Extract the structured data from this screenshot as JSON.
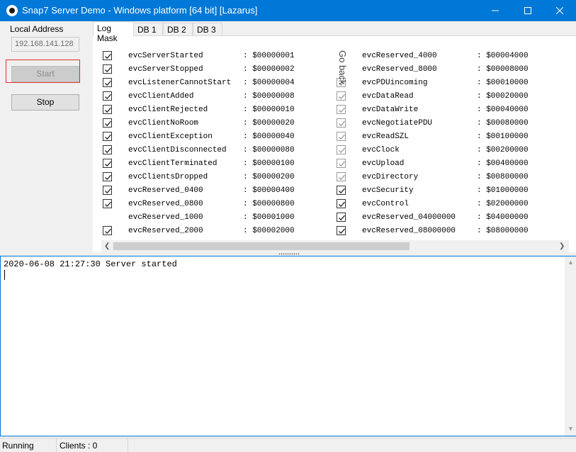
{
  "window": {
    "title": "Snap7 Server Demo - Windows platform [64 bit] [Lazarus]"
  },
  "left": {
    "address_label": "Local Address",
    "address_value": "192.168.141.128",
    "start_label": "Start",
    "stop_label": "Stop"
  },
  "tabs": [
    "Log Mask",
    "DB 1",
    "DB 2",
    "DB 3"
  ],
  "overlay_text": "Go back",
  "mask_left": [
    {
      "name": "evcServerStarted",
      "value": ": $00000001",
      "checked": true
    },
    {
      "name": "evcServerStopped",
      "value": ": $00000002",
      "checked": true
    },
    {
      "name": "evcListenerCannotStart",
      "value": ": $00000004",
      "checked": true
    },
    {
      "name": "evcClientAdded",
      "value": ": $00000008",
      "checked": true
    },
    {
      "name": "evcClientRejected",
      "value": ": $00000010",
      "checked": true
    },
    {
      "name": "evcClientNoRoom",
      "value": ": $00000020",
      "checked": true
    },
    {
      "name": "evcClientException",
      "value": ": $00000040",
      "checked": true
    },
    {
      "name": "evcClientDisconnected",
      "value": ": $00000080",
      "checked": true
    },
    {
      "name": "evcClientTerminated",
      "value": ": $00000100",
      "checked": true
    },
    {
      "name": "evcClientsDropped",
      "value": ": $00000200",
      "checked": true
    },
    {
      "name": "evcReserved_0400",
      "value": ": $00000400",
      "checked": true
    },
    {
      "name": "evcReserved_0800",
      "value": ": $00000800",
      "checked": true
    },
    {
      "name": "evcReserved_1000",
      "value": ": $00001000",
      "checked": false
    },
    {
      "name": "evcReserved_2000",
      "value": ": $00002000",
      "checked": true
    }
  ],
  "mask_right": [
    {
      "name": "evcReserved_4000",
      "value": ": $00004000",
      "checked": false,
      "dim": false
    },
    {
      "name": "evcReserved_8000",
      "value": ": $00008000",
      "checked": false,
      "dim": false
    },
    {
      "name": "evcPDUincoming",
      "value": ": $00010000",
      "checked": true,
      "dim": true
    },
    {
      "name": "evcDataRead",
      "value": ": $00020000",
      "checked": true,
      "dim": true
    },
    {
      "name": "evcDataWrite",
      "value": ": $00040000",
      "checked": true,
      "dim": true
    },
    {
      "name": "evcNegotiatePDU",
      "value": ": $00080000",
      "checked": true,
      "dim": true
    },
    {
      "name": "evcReadSZL",
      "value": ": $00100000",
      "checked": true,
      "dim": true
    },
    {
      "name": "evcClock",
      "value": ": $00200000",
      "checked": true,
      "dim": true
    },
    {
      "name": "evcUpload",
      "value": ": $00400000",
      "checked": true,
      "dim": true
    },
    {
      "name": "evcDirectory",
      "value": ": $00800000",
      "checked": true,
      "dim": true
    },
    {
      "name": "evcSecurity",
      "value": ": $01000000",
      "checked": true,
      "dim": false
    },
    {
      "name": "evcControl",
      "value": ": $02000000",
      "checked": true,
      "dim": false
    },
    {
      "name": "evcReserved_04000000",
      "value": ": $04000000",
      "checked": true,
      "dim": false
    },
    {
      "name": "evcReserved_08000000",
      "value": ": $08000000",
      "checked": true,
      "dim": false
    }
  ],
  "log": {
    "lines": [
      "2020-06-08 21:27:30 Server started"
    ]
  },
  "status": {
    "state": "Running",
    "clients": "Clients : 0"
  }
}
